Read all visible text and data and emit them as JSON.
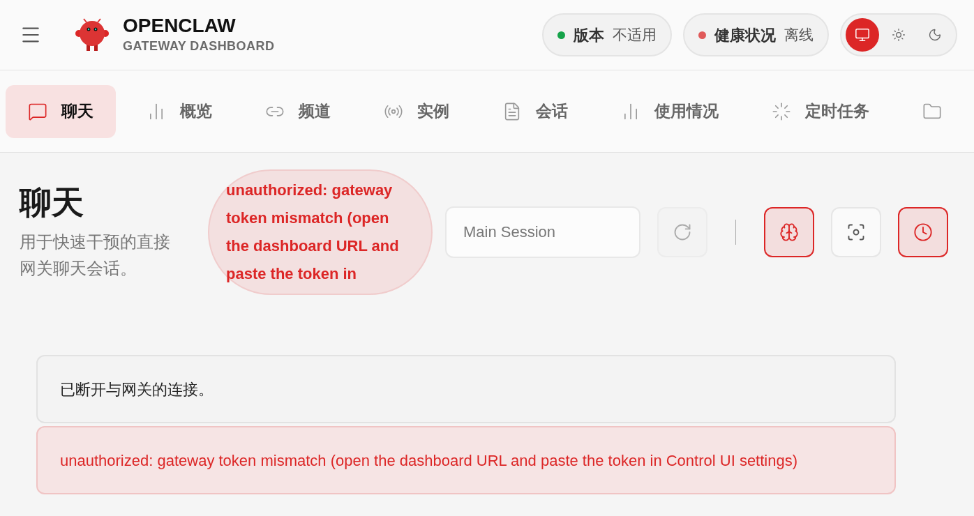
{
  "header": {
    "brand": "OPENCLAW",
    "subtitle": "GATEWAY DASHBOARD",
    "status": [
      {
        "label": "版本",
        "value": "不适用",
        "color": "#16a34a"
      },
      {
        "label": "健康状况",
        "value": "离线",
        "color": "#e05a5a"
      }
    ],
    "theme": [
      {
        "kind": "system",
        "selected": true
      },
      {
        "kind": "light",
        "selected": false
      },
      {
        "kind": "dark",
        "selected": false
      }
    ]
  },
  "tabs": [
    {
      "kind": "chat",
      "label": "聊天",
      "selected": true
    },
    {
      "kind": "bars",
      "label": "概览",
      "selected": false
    },
    {
      "kind": "link",
      "label": "频道",
      "selected": false
    },
    {
      "kind": "radio",
      "label": "实例",
      "selected": false
    },
    {
      "kind": "file",
      "label": "会话",
      "selected": false
    },
    {
      "kind": "bars",
      "label": "使用情况",
      "selected": false
    },
    {
      "kind": "loader",
      "label": "定时任务",
      "selected": false
    },
    {
      "kind": "folder",
      "selected": false
    }
  ],
  "page": {
    "title": "聊天",
    "subtitle": "用于快速干预的直接网关聊天会话。",
    "bubble": "unauthorized: gateway token mismatch (open the dashboard URL and paste the token in",
    "session_placeholder": "Main Session",
    "tools": [
      {
        "kind": "brain",
        "on": true
      },
      {
        "kind": "focus",
        "on": false
      },
      {
        "kind": "clock",
        "on": true
      }
    ]
  },
  "notices": [
    {
      "kind": "info",
      "text": "已断开与网关的连接。"
    },
    {
      "kind": "error",
      "text": "unauthorized: gateway token mismatch (open the dashboard URL and paste the token in Control UI settings)"
    }
  ]
}
